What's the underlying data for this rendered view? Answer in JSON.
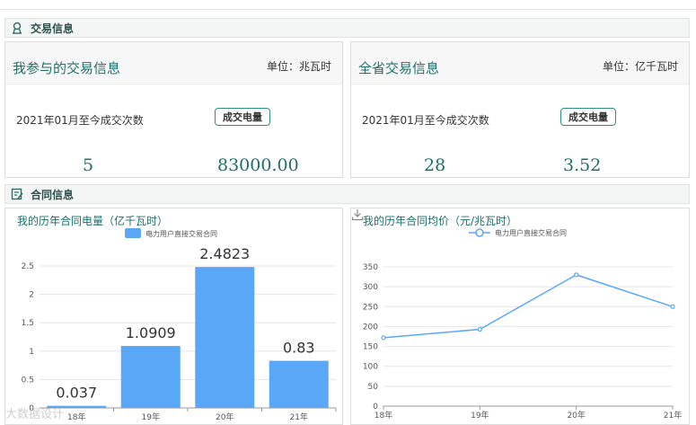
{
  "sections": {
    "trade": {
      "title": "交易信息",
      "icon": "badge-icon"
    },
    "contract": {
      "title": "合同信息",
      "icon": "document-edit-icon"
    }
  },
  "my_trade": {
    "title": "我参与的交易信息",
    "unit": "单位：兆瓦时",
    "label": "2021年01月至今成交次数",
    "badge": "成交电量",
    "count": "5",
    "volume": "83000.00"
  },
  "province_trade": {
    "title": "全省交易信息",
    "unit": "单位：亿千瓦时",
    "label": "2021年01月至今成交次数",
    "badge": "成交电量",
    "count": "28",
    "volume": "3.52"
  },
  "chart_data": [
    {
      "type": "bar",
      "title": "我的历年合同电量（亿千瓦时）",
      "categories": [
        "18年",
        "19年",
        "20年",
        "21年"
      ],
      "series": [
        {
          "name": "电力用户直接交易合同",
          "values": [
            0.037,
            1.0909,
            2.4823,
            0.83
          ],
          "labels": [
            "0.037",
            "1.0909",
            "2.4823",
            "0.83"
          ]
        }
      ],
      "ylim": [
        0,
        2.5
      ],
      "yticks": [
        "0",
        "0.5",
        "1",
        "1.5",
        "2",
        "2.5"
      ],
      "color": "#5aa7f8",
      "grid": true,
      "legend": "top"
    },
    {
      "type": "line",
      "title": "我的历年合同均价（元/兆瓦时）",
      "categories": [
        "18年",
        "19年",
        "20年",
        "21年"
      ],
      "series": [
        {
          "name": "电力用户直接交易合同",
          "values": [
            172,
            193,
            330,
            250
          ]
        }
      ],
      "ylim": [
        0,
        350
      ],
      "yticks": [
        "0",
        "50",
        "100",
        "150",
        "200",
        "250",
        "300",
        "350"
      ],
      "color": "#5aa7f8",
      "grid": true,
      "legend": "top"
    }
  ],
  "watermark": "大数据设计"
}
